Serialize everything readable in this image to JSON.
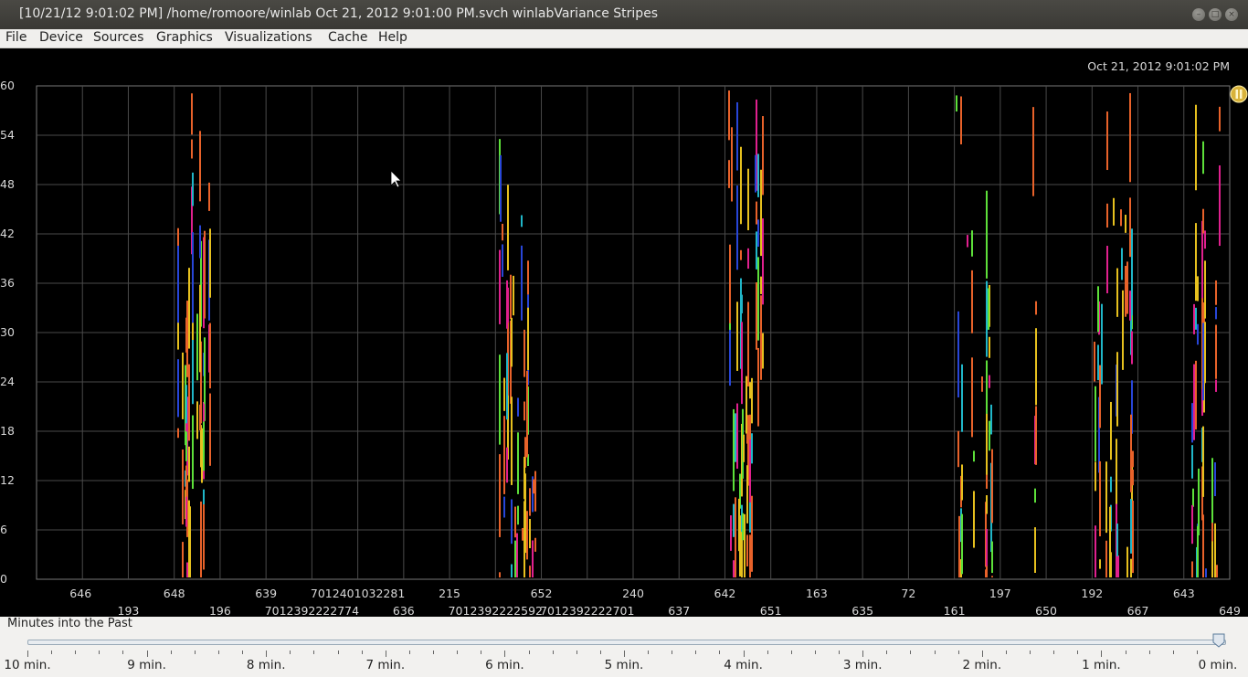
{
  "window": {
    "title": "[10/21/12 9:01:02 PM] /home/romoore/winlab Oct 21, 2012 9:01:00 PM.svch winlabVariance Stripes"
  },
  "menu": [
    "File",
    "Device",
    "Sources",
    "Graphics",
    "Visualizations",
    "Cache",
    "Help"
  ],
  "plot": {
    "timestamp": "Oct 21, 2012 9:01:02 PM",
    "y_ticks": [
      "60",
      "54",
      "48",
      "42",
      "36",
      "30",
      "24",
      "18",
      "12",
      "6",
      "0"
    ],
    "x_labels_row1": [
      "646",
      "648",
      "639",
      "7012401032281",
      "215",
      "652",
      "240",
      "642",
      "163",
      "72",
      "197",
      "192",
      "643"
    ],
    "x_labels_row2": [
      "193",
      "196",
      "7012392222774",
      "636",
      "7012392222592",
      "7012392222701",
      "637",
      "651",
      "635",
      "161",
      "650",
      "667",
      "649"
    ],
    "colors": {
      "orange": "#e8622a",
      "yellow": "#e6c01e",
      "green": "#5de03a",
      "magenta": "#e0208e",
      "blue": "#2846d8",
      "cyan": "#20b6c8",
      "grid": "#4a4a4a"
    }
  },
  "slider": {
    "label": "Minutes into the Past",
    "ticks": [
      "10 min.",
      "9 min.",
      "8 min.",
      "7 min.",
      "6 min.",
      "5 min.",
      "4 min.",
      "3 min.",
      "2 min.",
      "1 min.",
      "0 min."
    ]
  }
}
